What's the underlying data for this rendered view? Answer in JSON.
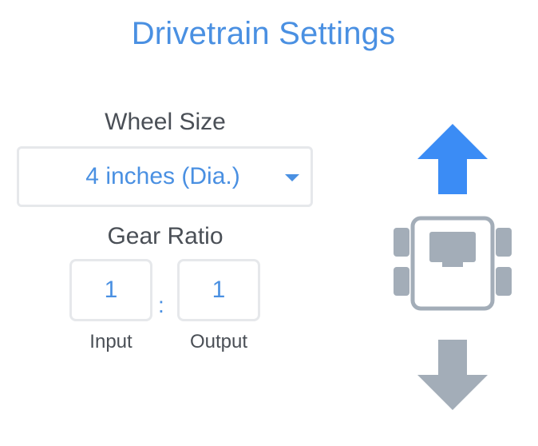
{
  "header": {
    "title": "Drivetrain Settings"
  },
  "wheel_size": {
    "label": "Wheel Size",
    "selected": "4 inches (Dia.)"
  },
  "gear_ratio": {
    "label": "Gear Ratio",
    "input_value": "1",
    "output_value": "1",
    "separator": ":",
    "input_label": "Input",
    "output_label": "Output"
  },
  "colors": {
    "accent": "#4a90e2",
    "forward_arrow": "#3b8cf5",
    "reverse_arrow": "#a3adb8",
    "robot": "#a3adb8",
    "text": "#4a4f56",
    "border": "#e6e8eb"
  },
  "icons": {
    "forward": "arrow-up-icon",
    "reverse": "arrow-down-icon",
    "robot": "robot-topview-icon",
    "dropdown": "chevron-down-icon"
  }
}
